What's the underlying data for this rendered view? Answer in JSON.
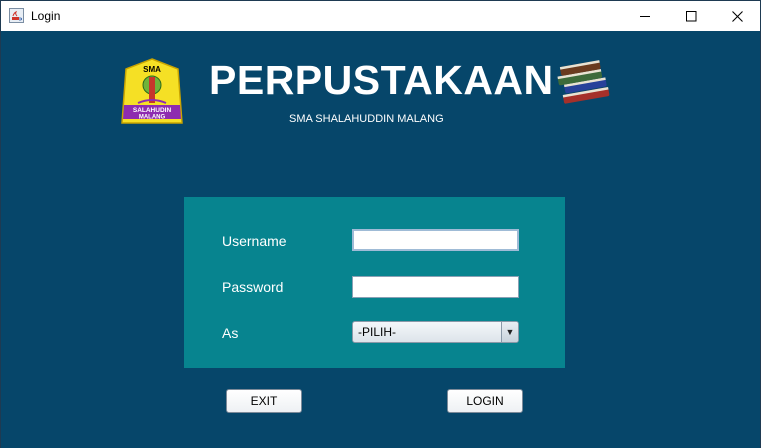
{
  "window": {
    "title": "Login",
    "app_icon": "java-coffee-icon",
    "controls": [
      "minimize-icon",
      "maximize-icon",
      "close-icon"
    ]
  },
  "header": {
    "logo_text_top": "SMA",
    "logo_text_name": "SALAHUDIN",
    "logo_text_city": "MALANG",
    "title": "PERPUSTAKAAN",
    "subtitle": "SMA SHALAHUDDIN MALANG",
    "decor_icon": "books-stack-icon"
  },
  "form": {
    "username_label": "Username",
    "username_value": "",
    "password_label": "Password",
    "password_value": "",
    "role_label": "As",
    "role_selected": "-PILIH-"
  },
  "buttons": {
    "exit_label": "EXIT",
    "login_label": "LOGIN"
  },
  "colors": {
    "background": "#06466a",
    "panel": "#07848f",
    "logo_yellow": "#f5e025",
    "logo_purple": "#8e2cb0"
  }
}
